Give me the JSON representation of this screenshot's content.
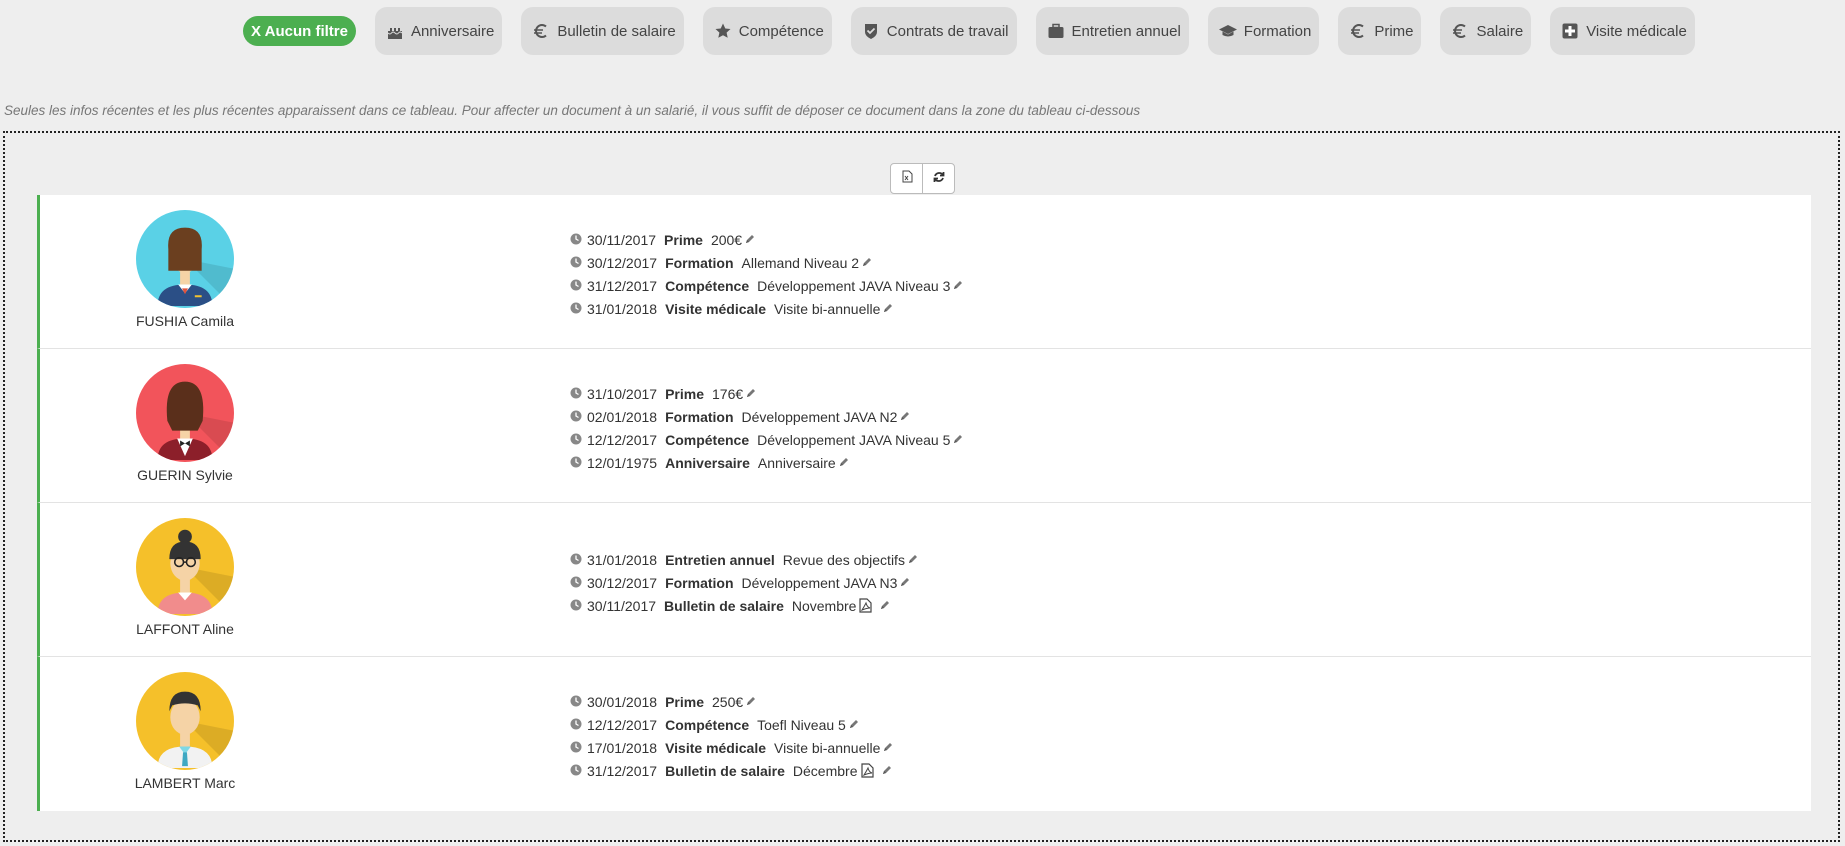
{
  "filters": {
    "active_label": "X Aucun filtre",
    "items": [
      {
        "label": "Anniversaire",
        "icon": "cake-icon"
      },
      {
        "label": "Bulletin de salaire",
        "icon": "euro-icon"
      },
      {
        "label": "Compétence",
        "icon": "star-icon"
      },
      {
        "label": "Contrats de travail",
        "icon": "shield-check-icon"
      },
      {
        "label": "Entretien annuel",
        "icon": "briefcase-icon"
      },
      {
        "label": "Formation",
        "icon": "graduation-cap-icon"
      },
      {
        "label": "Prime",
        "icon": "euro-icon"
      },
      {
        "label": "Salaire",
        "icon": "euro-icon"
      },
      {
        "label": "Visite médicale",
        "icon": "medical-cross-icon"
      }
    ]
  },
  "info_text": "Seules les infos récentes et les plus récentes apparaissent dans ce tableau.  Pour affecter un document à un salarié, il vous suffit de déposer ce document dans la zone du tableau ci-dessous",
  "toolbar": {
    "export_icon": "excel-export-icon",
    "refresh_icon": "refresh-icon"
  },
  "colors": {
    "accent": "#4caf50",
    "chip_bg": "#dcdcdc",
    "page_bg": "#eeeeee"
  },
  "employees": [
    {
      "name": "FUSHIA Camila",
      "avatar_bg": "#5ad1e6",
      "events": [
        {
          "date": "30/11/2017",
          "type": "Prime",
          "detail": "200€",
          "pdf": false
        },
        {
          "date": "30/12/2017",
          "type": "Formation",
          "detail": "Allemand Niveau 2",
          "pdf": false
        },
        {
          "date": "31/12/2017",
          "type": "Compétence",
          "detail": "Développement JAVA Niveau 3",
          "pdf": false
        },
        {
          "date": "31/01/2018",
          "type": "Visite médicale",
          "detail": "Visite bi-annuelle",
          "pdf": false
        }
      ]
    },
    {
      "name": "GUERIN Sylvie",
      "avatar_bg": "#f2545b",
      "events": [
        {
          "date": "31/10/2017",
          "type": "Prime",
          "detail": "176€",
          "pdf": false
        },
        {
          "date": "02/01/2018",
          "type": "Formation",
          "detail": "Développement JAVA N2",
          "pdf": false
        },
        {
          "date": "12/12/2017",
          "type": "Compétence",
          "detail": "Développement JAVA Niveau 5",
          "pdf": false
        },
        {
          "date": "12/01/1975",
          "type": "Anniversaire",
          "detail": "Anniversaire",
          "pdf": false
        }
      ]
    },
    {
      "name": "LAFFONT Aline",
      "avatar_bg": "#f5c02a",
      "events": [
        {
          "date": "31/01/2018",
          "type": "Entretien annuel",
          "detail": "Revue des objectifs",
          "pdf": false
        },
        {
          "date": "30/12/2017",
          "type": "Formation",
          "detail": "Développement JAVA N3",
          "pdf": false
        },
        {
          "date": "30/11/2017",
          "type": "Bulletin de salaire",
          "detail": "Novembre",
          "pdf": true
        }
      ]
    },
    {
      "name": "LAMBERT Marc",
      "avatar_bg": "#f5c02a",
      "events": [
        {
          "date": "30/01/2018",
          "type": "Prime",
          "detail": "250€",
          "pdf": false
        },
        {
          "date": "12/12/2017",
          "type": "Compétence",
          "detail": "Toefl Niveau 5",
          "pdf": false
        },
        {
          "date": "17/01/2018",
          "type": "Visite médicale",
          "detail": "Visite bi-annuelle",
          "pdf": false
        },
        {
          "date": "31/12/2017",
          "type": "Bulletin de salaire",
          "detail": "Décembre",
          "pdf": true
        }
      ]
    }
  ]
}
